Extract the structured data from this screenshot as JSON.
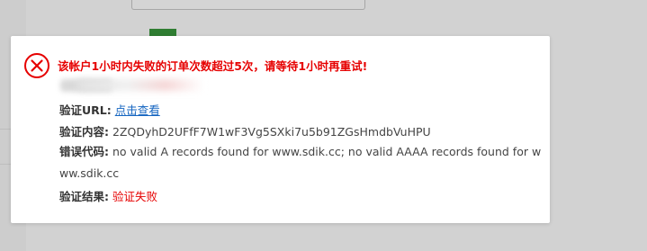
{
  "dialog": {
    "error_title": "该帐户1小时内失败的订单次数超过5次，请等待1小时再重试!",
    "fields": {
      "url_label": "验证URL:",
      "url_link": "点击查看",
      "content_label": "验证内容:",
      "content_value": "2ZQDyhD2UFfF7W1wF3Vg5SXki7u5b91ZGsHmdbVuHPU",
      "error_code_label": "错误代码:",
      "error_code_value": "no valid A records found for www.sdik.cc; no valid AAAA records found for www.sdik.cc",
      "result_label": "验证结果:",
      "result_value": "验证失败"
    }
  },
  "colors": {
    "error_red": "#e60000",
    "link_blue": "#1565c0",
    "overlay_gray": "#d2d2d2"
  },
  "icons": {
    "error": "circle-x-icon"
  }
}
